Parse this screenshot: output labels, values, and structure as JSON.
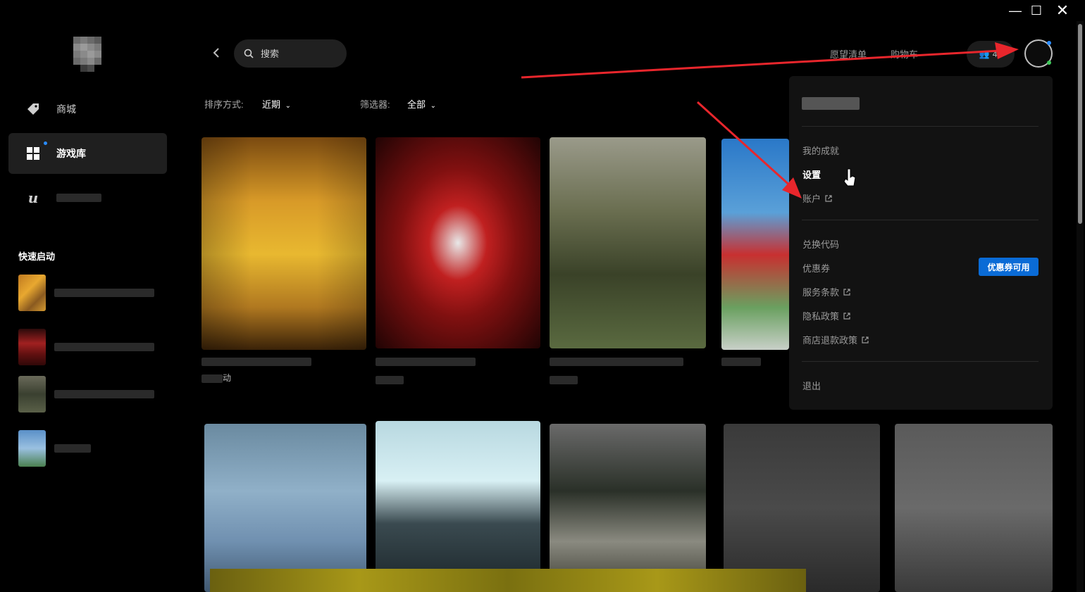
{
  "window": {
    "minimize_glyph": "—",
    "maximize_glyph": "☐",
    "close_glyph": "✕"
  },
  "sidebar": {
    "items": [
      {
        "label": "商城",
        "icon": "tag-icon"
      },
      {
        "label": "游戏库",
        "icon": "grid-icon"
      },
      {
        "label": "",
        "icon": "unreal-icon"
      }
    ],
    "quick_launch_title": "快速启动"
  },
  "header": {
    "search_placeholder": "搜索",
    "wishlist": "愿望清单",
    "cart": "购物车",
    "friends_count": "45"
  },
  "filters": {
    "sort_label": "排序方式:",
    "sort_value": "近期",
    "filter_label": "筛选器:",
    "filter_value": "全部"
  },
  "cards": {
    "first_sub": "动"
  },
  "menu": {
    "achievements": "我的成就",
    "settings": "设置",
    "account": "账户",
    "redeem": "兑换代码",
    "coupons": "优惠券",
    "coupon_badge": "优惠券可用",
    "terms": "服务条款",
    "privacy": "隐私政策",
    "refund": "商店退款政策",
    "logout": "退出"
  },
  "colors": {
    "accent": "#0a6bd6",
    "annotation": "#e8262c"
  }
}
